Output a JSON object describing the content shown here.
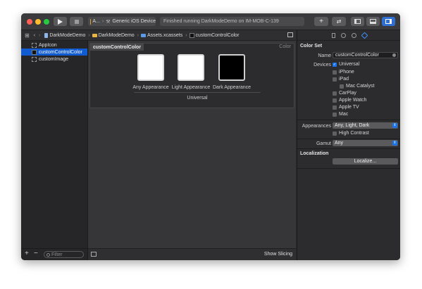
{
  "toolbar": {
    "scheme": "A...",
    "device": "Generic iOS Device",
    "activity": "Finished running DarkModeDemo on IM-MOB-C-139"
  },
  "jumpbar": {
    "crumbs": [
      "DarkModeDemo",
      "DarkModeDemo",
      "Assets.xcassets",
      "customControlColor"
    ]
  },
  "navigator": {
    "items": [
      {
        "label": "AppIcon"
      },
      {
        "label": "customControlColor"
      },
      {
        "label": "customImage"
      }
    ],
    "filter_placeholder": "Filter"
  },
  "editor": {
    "panel_title": "customControlColor",
    "panel_kind": "Color",
    "appearances": [
      "Any Appearance",
      "Light Appearance",
      "Dark Appearance"
    ],
    "group_label": "Universal",
    "show_slicing": "Show Slicing"
  },
  "inspector": {
    "section_title": "Color Set",
    "name_label": "Name",
    "name_value": "customControlColor",
    "devices_label": "Devices",
    "devices": [
      {
        "label": "Universal",
        "checked": true
      },
      {
        "label": "iPhone",
        "checked": false
      },
      {
        "label": "iPad",
        "checked": false
      },
      {
        "label": "Mac Catalyst",
        "checked": false
      },
      {
        "label": "CarPlay",
        "checked": false
      },
      {
        "label": "Apple Watch",
        "checked": false
      },
      {
        "label": "Apple TV",
        "checked": false
      },
      {
        "label": "Mac",
        "checked": false
      }
    ],
    "appearances_label": "Appearances",
    "appearances_value": "Any, Light, Dark",
    "high_contrast": "High Contrast",
    "gamut_label": "Gamut",
    "gamut_value": "Any",
    "localization_title": "Localization",
    "localize_button": "Localize..."
  },
  "colors": {
    "accent": "#1a73e8",
    "selection": "#0f5bcf",
    "well_light": "#ffffff",
    "well_dark": "#000000"
  }
}
